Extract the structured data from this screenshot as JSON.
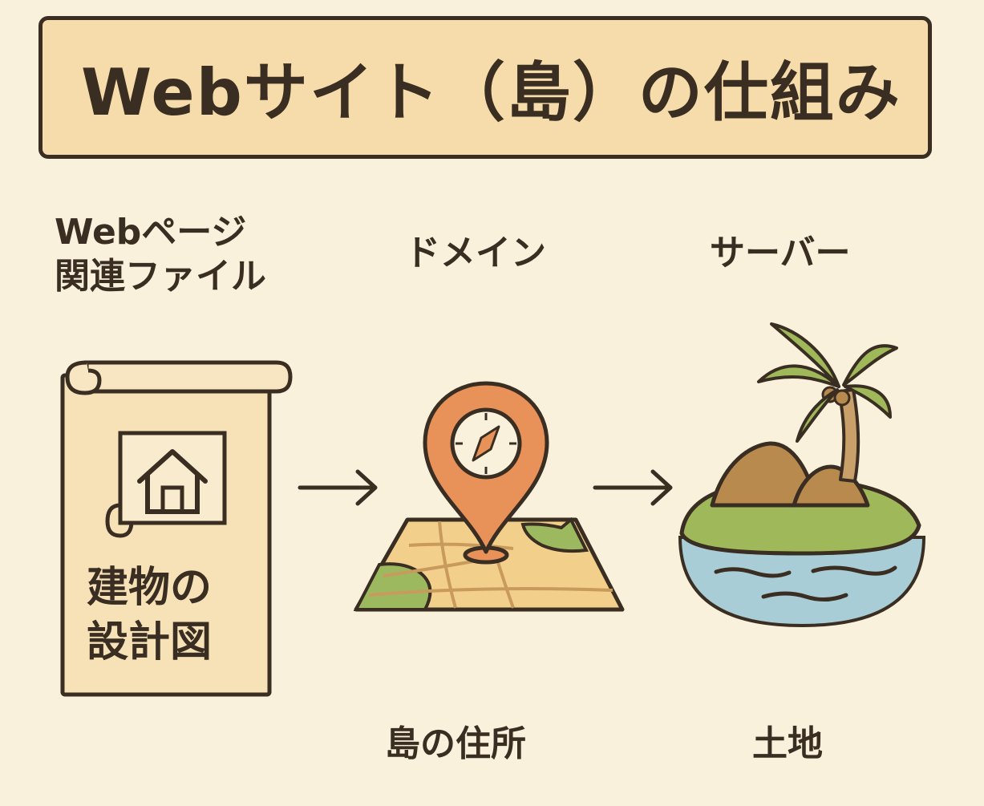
{
  "title": "Webサイト（島）の仕組み",
  "columns": [
    {
      "label_lines": [
        "Webページ",
        "関連ファイル"
      ],
      "icon": "blueprint-scroll-icon",
      "caption_lines": [
        "建物の",
        "設計図"
      ]
    },
    {
      "label": "ドメイン",
      "icon": "map-pin-icon",
      "caption": "島の住所"
    },
    {
      "label": "サーバー",
      "icon": "island-icon",
      "caption": "土地"
    }
  ],
  "colors": {
    "background": "#faf1dc",
    "title_box": "#f6dcaa",
    "outline": "#3a2e22",
    "pin": "#e8925a",
    "map": "#f3cf8c",
    "map_green": "#9cb960",
    "island_green": "#9fb85a",
    "island_brown": "#b98a4e",
    "water": "#a9cdd6"
  }
}
